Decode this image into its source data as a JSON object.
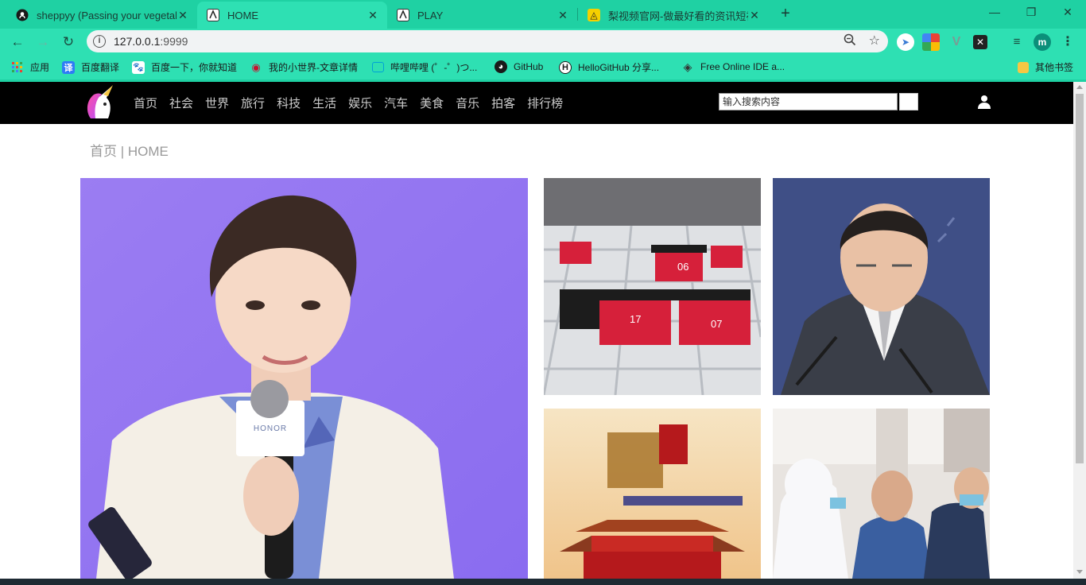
{
  "browser": {
    "tabs": [
      {
        "title": "sheppyy (Passing your vegetal",
        "favicon": "github-icon",
        "active": false
      },
      {
        "title": "HOME",
        "favicon": "site-icon",
        "active": true
      },
      {
        "title": "PLAY",
        "favicon": "site-icon",
        "active": false
      },
      {
        "title": "梨视频官网-做最好看的资讯短视",
        "favicon": "pear-icon",
        "active": false
      }
    ],
    "new_tab": "+",
    "address": {
      "host": "127.0.0.1",
      "port": ":9999"
    },
    "profile_initial": "m",
    "bookmarks": [
      {
        "label": "应用",
        "icon": "apps-icon"
      },
      {
        "label": "百度翻译",
        "icon": "translate-icon"
      },
      {
        "label": "百度一下，你就知道",
        "icon": "baidu-icon"
      },
      {
        "label": "我的小世界-文章详情",
        "icon": "lips-icon"
      },
      {
        "label": "哔哩哔哩 (゜-゜)つ...",
        "icon": "bilibili-icon"
      },
      {
        "label": "GitHub",
        "icon": "github-icon"
      },
      {
        "label": "HelloGitHub 分享...",
        "icon": "hellogithub-icon"
      },
      {
        "label": "Free Online IDE a...",
        "icon": "ide-icon"
      },
      {
        "label": "其他书签",
        "icon": "folder-icon"
      }
    ]
  },
  "site": {
    "nav": [
      "首页",
      "社会",
      "世界",
      "旅行",
      "科技",
      "生活",
      "娱乐",
      "汽车",
      "美食",
      "音乐",
      "拍客",
      "排行榜"
    ],
    "search_placeholder": "输入搜索内容",
    "breadcrumb": "首页 | HOME"
  },
  "colors": {
    "tabbar": "#1fd1a3",
    "toolbar": "#2ee0b3",
    "header": "#000000",
    "nav_text": "#cccccc"
  }
}
